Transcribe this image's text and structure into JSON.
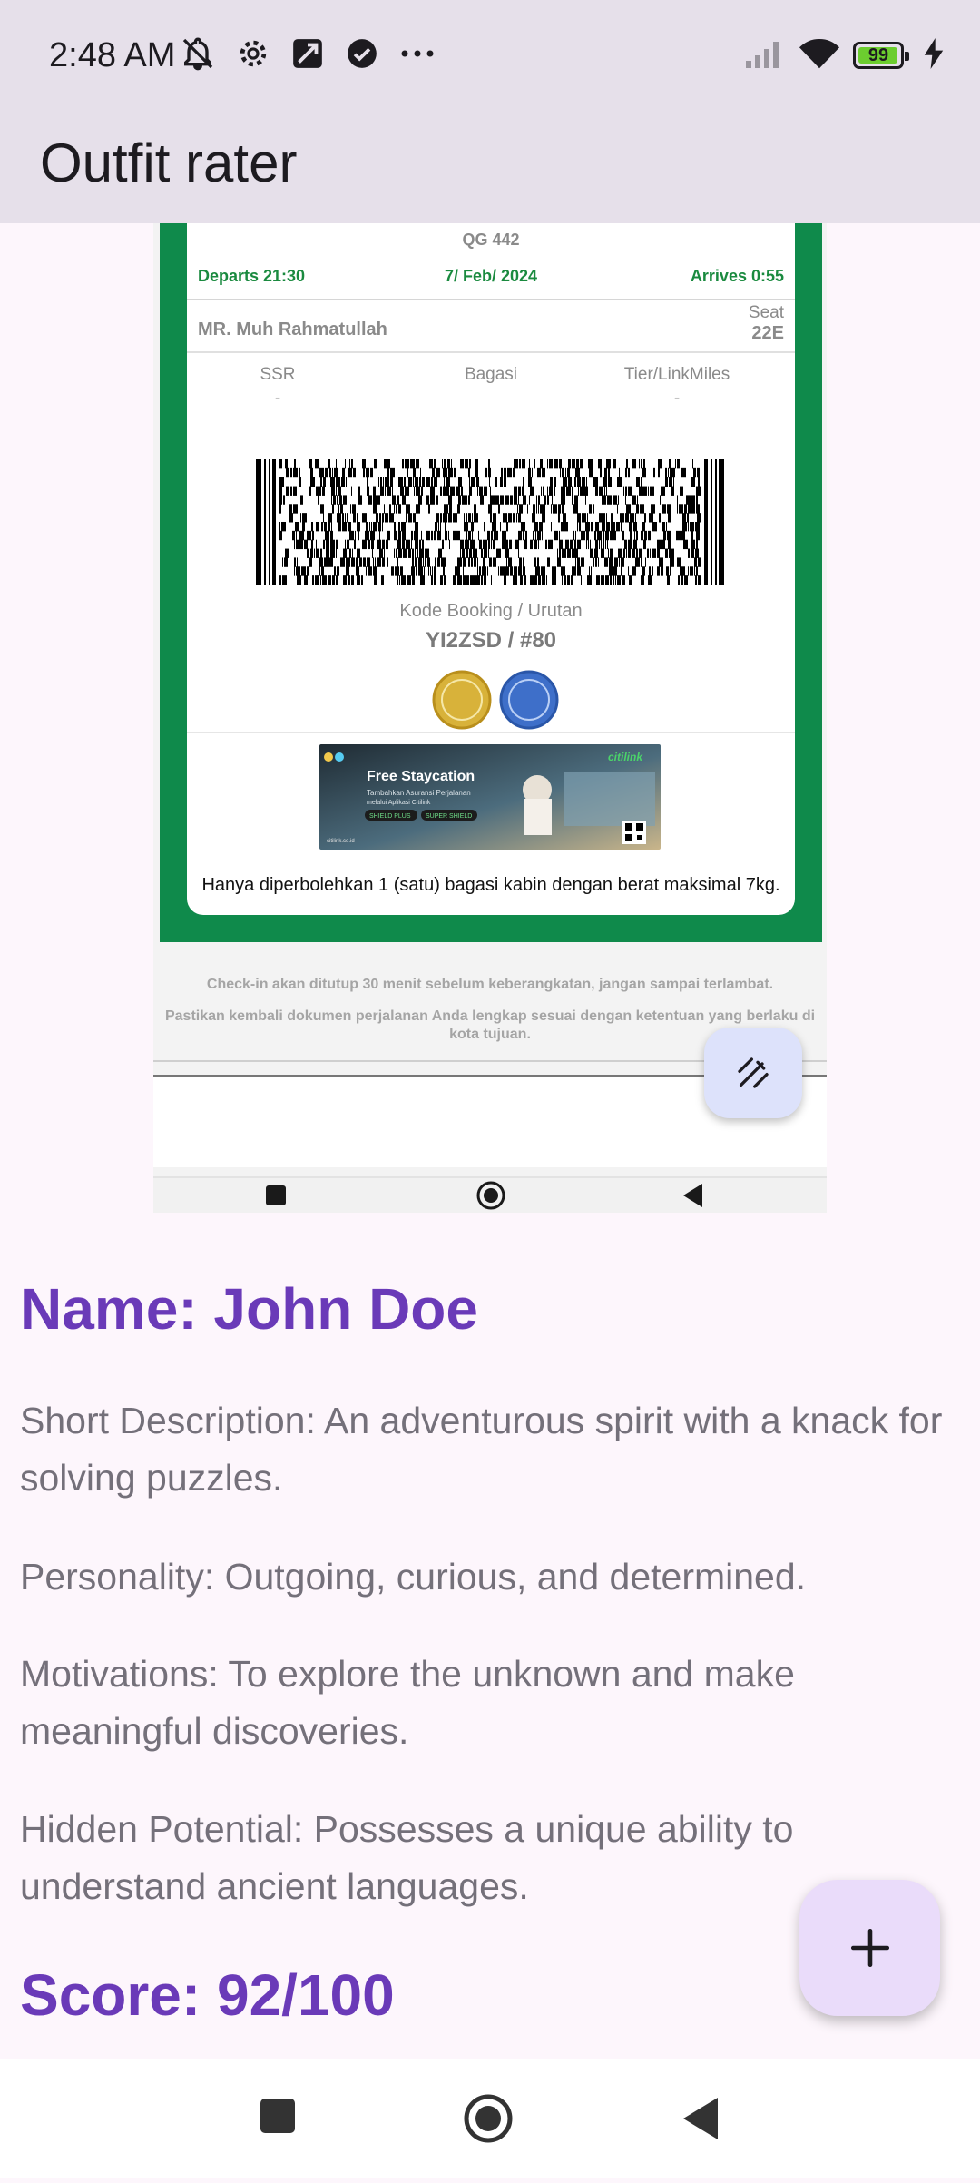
{
  "status_bar": {
    "time": "2:48 AM",
    "battery_level": "99",
    "left_icons": [
      "notifications-off-icon",
      "gear-icon",
      "vpn-key-icon",
      "check-circle-icon",
      "more-dots-icon"
    ],
    "right_icons": [
      "cellular-signal-icon",
      "wifi-icon",
      "battery-icon",
      "charging-icon"
    ]
  },
  "app_bar": {
    "title": "Outfit rater"
  },
  "ticket_image": {
    "flight": "QG 442",
    "departs": "Departs  21:30",
    "date": "7/ Feb/ 2024",
    "arrives": "Arrives  0:55",
    "passenger": "MR. Muh Rahmatullah",
    "seat_label": "Seat",
    "seat_value": "22E",
    "columns": [
      {
        "label": "SSR",
        "value": "-"
      },
      {
        "label": "Bagasi",
        "value": ""
      },
      {
        "label": "Tier/LinkMiles",
        "value": "-"
      }
    ],
    "booking_label": "Kode Booking / Urutan",
    "booking_code": "YI2ZSD / #80",
    "promo": {
      "title": "Free Staycation",
      "brand": "citilink",
      "lines": [
        "Tambahkan Asuransi Perjalanan",
        "melalui Aplikasi Citilink"
      ],
      "tags": [
        "SHIELD PLUS",
        "SUPER SHIELD"
      ],
      "url": "citilink.co.id"
    },
    "note": "Hanya diperbolehkan 1 (satu) bagasi kabin dengan berat maksimal 7kg.",
    "footer_line1": "Check-in akan ditutup 30 menit sebelum keberangkatan, jangan sampai terlambat.",
    "footer_line2": "Pastikan kembali dokumen perjalanan Anda lengkap sesuai dengan ketentuan yang berlaku di kota tujuan."
  },
  "character": {
    "name": "Name: John Doe",
    "short_description": "Short Description: An adventurous spirit with a knack for solving puzzles.",
    "personality": "Personality: Outgoing, curious, and determined.",
    "motivations": "Motivations: To explore the unknown and make meaningful discoveries.",
    "hidden_potential": "Hidden Potential: Possesses a unique ability to understand ancient languages.",
    "score": "Score: 92/100"
  },
  "fab": {
    "icon": "plus-icon"
  },
  "edit_fab": {
    "icon": "edit-stroke-icon"
  },
  "nav": {
    "icons": [
      "recents-square-icon",
      "home-circle-icon",
      "back-triangle-icon"
    ]
  },
  "colors": {
    "accent_purple": "#6a3ab8",
    "body_text": "#74707a",
    "bar_bg": "#e6e0ea",
    "page_bg": "#fdf6fc",
    "ticket_green": "#0f8a4b"
  }
}
